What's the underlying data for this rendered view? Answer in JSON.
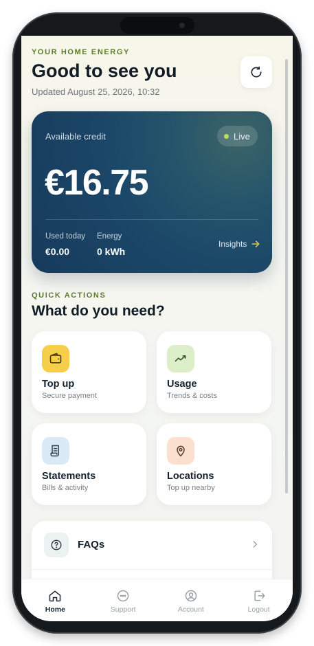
{
  "header": {
    "eyebrow": "YOUR HOME ENERGY",
    "greeting": "Good to see you",
    "updated": "Updated August 25, 2026, 10:32",
    "refresh_icon": "refresh-icon"
  },
  "credit_card": {
    "label": "Available credit",
    "status": "Live",
    "amount": "€16.75",
    "stats": [
      {
        "label": "Used today",
        "value": "€0.00"
      },
      {
        "label": "Energy",
        "value": "0 kWh"
      }
    ],
    "insights_label": "Insights",
    "colors": {
      "card": "#1b4668",
      "live_dot": "#b8e163",
      "insights_arrow": "#e4c94a"
    }
  },
  "quick_actions": {
    "eyebrow": "QUICK ACTIONS",
    "title": "What do you need?",
    "tiles": [
      {
        "title": "Top up",
        "subtitle": "Secure payment",
        "icon": "wallet-icon",
        "color": "#f6cf4a"
      },
      {
        "title": "Usage",
        "subtitle": "Trends & costs",
        "icon": "trend-icon",
        "color": "#dcefc8"
      },
      {
        "title": "Statements",
        "subtitle": "Bills & activity",
        "icon": "receipt-icon",
        "color": "#d9e9f6"
      },
      {
        "title": "Locations",
        "subtitle": "Top up nearby",
        "icon": "location-pin-icon",
        "color": "#fbe0cf"
      }
    ]
  },
  "faq": {
    "label": "FAQs",
    "icon": "question-icon"
  },
  "tabs": [
    {
      "label": "Home",
      "icon": "home-icon",
      "active": true
    },
    {
      "label": "Support",
      "icon": "chat-icon",
      "active": false
    },
    {
      "label": "Account",
      "icon": "user-icon",
      "active": false
    },
    {
      "label": "Logout",
      "icon": "logout-icon",
      "active": false
    }
  ]
}
